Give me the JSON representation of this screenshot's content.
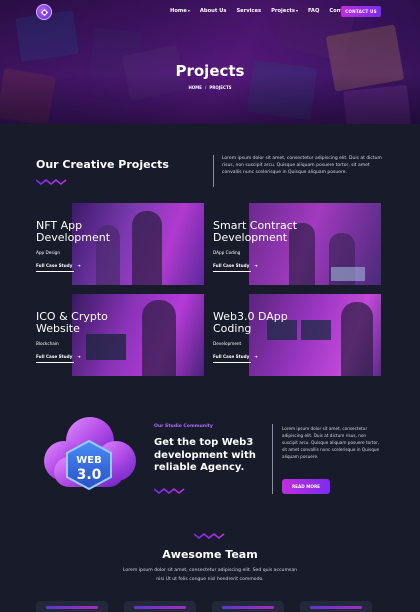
{
  "nav": {
    "items": [
      {
        "label": "Home",
        "dropdown": true
      },
      {
        "label": "About Us",
        "dropdown": false
      },
      {
        "label": "Services",
        "dropdown": false
      },
      {
        "label": "Projects",
        "dropdown": true
      },
      {
        "label": "FAQ",
        "dropdown": false
      },
      {
        "label": "Contact",
        "dropdown": false
      }
    ],
    "cta": "CONTACT US",
    "logo_icon": "gamepad-icon"
  },
  "hero": {
    "title": "Projects",
    "breadcrumb": [
      "HOME",
      "PROJECTS"
    ]
  },
  "creative": {
    "heading": "Our Creative Projects",
    "intro": "Lorem ipsum dolor sit amet, consectetur adipiscing elit. Duis at dictum risus, non suscipit arcu. Quisque aliquam posuere tortor, sit amet convallis nunc scelerisque in Quisque aliquam posuere."
  },
  "projects": [
    {
      "title": "NFT App Development",
      "category": "App Design",
      "link": "Full Case Study"
    },
    {
      "title": "Smart Contract Development",
      "category": "DApp Coding",
      "link": "Full Case Study"
    },
    {
      "title": "ICO & Crypto Website",
      "category": "Blockchain",
      "link": "Full Case Study"
    },
    {
      "title": "Web3.0 DApp Coding",
      "category": "Development",
      "link": "Full Case Study"
    }
  ],
  "community": {
    "eyebrow": "Our Studio Community",
    "heading": "Get the top Web3 development with reliable Agency.",
    "badge_line1": "WEB",
    "badge_line2": "3.0",
    "text": "Lorem ipsum dolor sit amet, consectetur adipiscing elit. Duis at dictum risus, non suscipit arcu. Quisque aliquam posuere tortor, sit amet convallis nunc scelerisque in Quisque aliquam posuere.",
    "button": "READ MORE"
  },
  "team": {
    "heading": "Awesome Team",
    "text": "Lorem ipsum dolor sit amet, consectetur adipiscing elit. Sed quis accumsan nisi Ut ut felis congue nisl hendrerit commodo."
  },
  "colors": {
    "background": "#171b2a",
    "accent_pink": "#c02de0",
    "accent_purple": "#7a2cf0",
    "eyebrow": "#b56bff"
  }
}
